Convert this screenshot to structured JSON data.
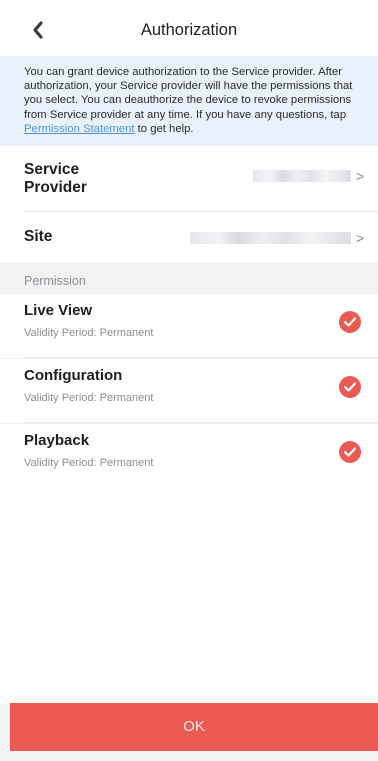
{
  "header": {
    "title": "Authorization",
    "back_icon": "chevron-left-icon"
  },
  "notice": {
    "text_before": "You can grant device authorization to the Service provider. After authorization, your Service provider will have the permissions that you select. You can deauthorize the device to revoke permissions from Service provider at any time. If you have any questions, tap ",
    "link": "Permission Statement",
    "text_after": " to get help."
  },
  "service_provider": {
    "label": "Service\nProvider",
    "chevron": ">"
  },
  "site": {
    "label": "Site",
    "chevron": ">"
  },
  "permission_section": {
    "label": "Permission"
  },
  "permissions": [
    {
      "name": "Live View",
      "validity": "Validity Period:  Permanent",
      "checked": true
    },
    {
      "name": "Configuration",
      "validity": "Validity Period:  Permanent",
      "checked": true
    },
    {
      "name": "Playback",
      "validity": "Validity Period:  Permanent",
      "checked": true
    }
  ],
  "ok_button": {
    "label": "OK"
  },
  "colors": {
    "accent": "#ec5a54",
    "link": "#4f93d6",
    "notice_bg": "#e9f2fc"
  }
}
